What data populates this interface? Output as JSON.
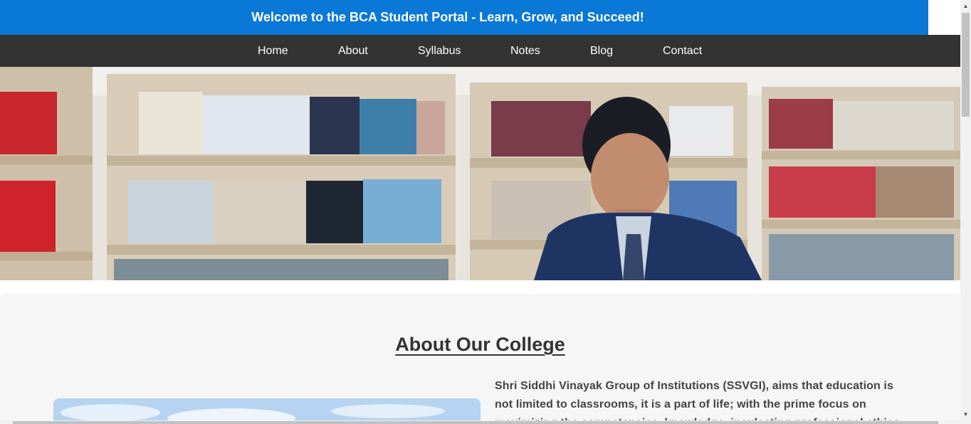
{
  "banner": {
    "text": "Welcome to the BCA Student Portal - Learn, Grow, and Succeed!",
    "close_glyph": "✕",
    "color": "#0a78d6"
  },
  "nav": {
    "items": [
      {
        "label": "Home"
      },
      {
        "label": "About"
      },
      {
        "label": "Syllabus"
      },
      {
        "label": "Notes"
      },
      {
        "label": "Blog"
      },
      {
        "label": "Contact"
      }
    ],
    "background": "#333333"
  },
  "hero": {
    "icon": "library-photo"
  },
  "about": {
    "title": "About Our College",
    "paragraph_lines": [
      "Shri Siddhi Vinayak Group of Institutions (SSVGI), aims that education is",
      "not limited to classrooms, it is a part of life; with the prime focus on",
      "maximizing the competencies, knowledge, inculcating professional ethics"
    ]
  },
  "scrollbars": {
    "up_glyph": "▲",
    "down_glyph": "▼"
  }
}
